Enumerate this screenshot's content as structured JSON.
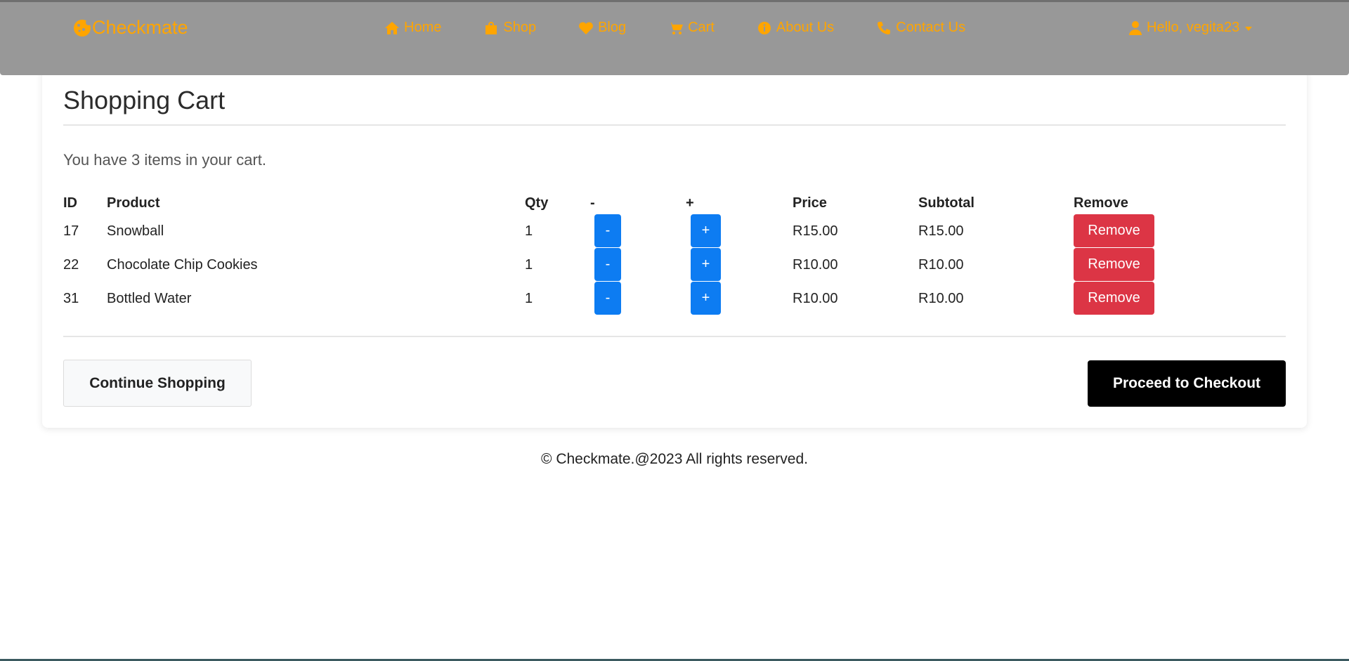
{
  "nav": {
    "brand": "Checkmate",
    "links": [
      {
        "label": "Home",
        "icon": "home-icon"
      },
      {
        "label": "Shop",
        "icon": "shopping-bag-icon"
      },
      {
        "label": "Blog",
        "icon": "heart-icon"
      },
      {
        "label": "Cart",
        "icon": "cart-icon"
      },
      {
        "label": "About Us",
        "icon": "info-icon"
      },
      {
        "label": "Contact Us",
        "icon": "phone-icon"
      }
    ],
    "user_greeting": "Hello, vegita23"
  },
  "cart": {
    "title": "Shopping Cart",
    "message": "You have 3 items in your cart.",
    "headers": {
      "id": "ID",
      "product": "Product",
      "qty": "Qty",
      "minus": "-",
      "plus": "+",
      "price": "Price",
      "subtotal": "Subtotal",
      "remove": "Remove"
    },
    "rows": [
      {
        "id": "17",
        "product": "Snowball",
        "qty": "1",
        "price": "R15.00",
        "subtotal": "R15.00"
      },
      {
        "id": "22",
        "product": "Chocolate Chip Cookies",
        "qty": "1",
        "price": "R10.00",
        "subtotal": "R10.00"
      },
      {
        "id": "31",
        "product": "Bottled Water",
        "qty": "1",
        "price": "R10.00",
        "subtotal": "R10.00"
      }
    ],
    "minus_label": "-",
    "plus_label": "+",
    "remove_label": "Remove",
    "continue_label": "Continue Shopping",
    "checkout_label": "Proceed to Checkout"
  },
  "footer": {
    "text": "© Checkmate.@2023 All rights reserved."
  },
  "colors": {
    "navbar_bg": "#989898",
    "nav_accent": "#ffa500",
    "btn_blue": "#0d7cf2",
    "btn_red": "#dc3545",
    "btn_checkout": "#000000"
  }
}
